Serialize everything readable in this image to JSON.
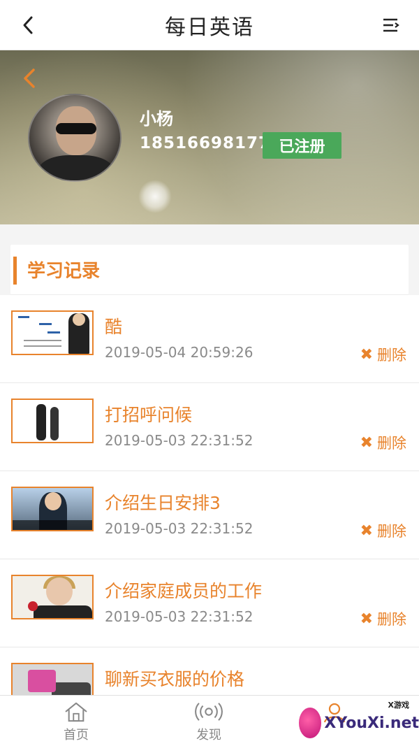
{
  "topbar": {
    "title": "每日英语",
    "back_icon": "chevron-left-icon",
    "menu_icon": "menu-lines-icon"
  },
  "profile": {
    "name": "小杨",
    "phone": "18516698177",
    "status_badge": "已注册",
    "badge_color": "#4aa85a"
  },
  "section": {
    "title": "学习记录",
    "accent": "#e8832c"
  },
  "records": [
    {
      "title": "酷",
      "time": "2019-05-04 20:59:26",
      "delete_label": "删除"
    },
    {
      "title": "打招呼问候",
      "time": "2019-05-03 22:31:52",
      "delete_label": "删除"
    },
    {
      "title": "介绍生日安排3",
      "time": "2019-05-03 22:31:52",
      "delete_label": "删除"
    },
    {
      "title": "介绍家庭成员的工作",
      "time": "2019-05-03 22:31:52",
      "delete_label": "删除"
    },
    {
      "title": "聊新买衣服的价格",
      "time": "",
      "delete_label": ""
    }
  ],
  "tabs": [
    {
      "label": "首页",
      "icon": "home-icon"
    },
    {
      "label": "发现",
      "icon": "broadcast-icon"
    },
    {
      "label": "",
      "icon": "user-icon"
    }
  ],
  "watermark": {
    "big": "XYouXi.net",
    "small": "X游戏"
  }
}
